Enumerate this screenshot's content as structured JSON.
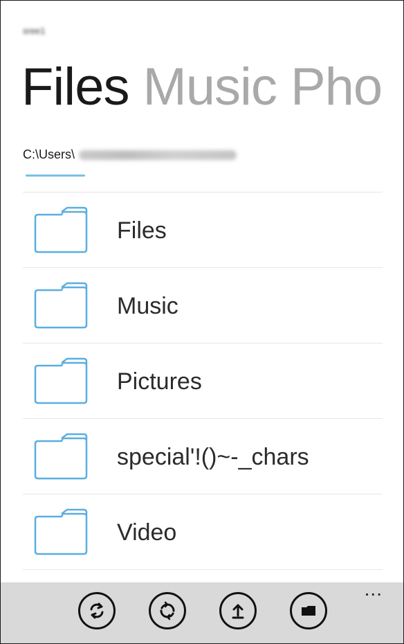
{
  "header": {
    "username": "sree1",
    "pivots": [
      {
        "label": "Files",
        "active": true
      },
      {
        "label": "Music",
        "active": false
      },
      {
        "label": "Pho",
        "active": false
      }
    ]
  },
  "path": {
    "prefix": "C:\\Users\\",
    "hidden_part": "redacted"
  },
  "folders": [
    {
      "name": "Files",
      "icon": "folder-icon"
    },
    {
      "name": "Music",
      "icon": "folder-icon"
    },
    {
      "name": "Pictures",
      "icon": "folder-icon"
    },
    {
      "name": "special'!()~-_chars",
      "icon": "folder-icon"
    },
    {
      "name": "Video",
      "icon": "folder-icon"
    }
  ],
  "appbar": {
    "buttons": [
      {
        "icon": "sync-icon"
      },
      {
        "icon": "refresh-icon"
      },
      {
        "icon": "upload-icon"
      },
      {
        "icon": "folder-icon"
      }
    ],
    "more_label": "..."
  },
  "colors": {
    "accent": "#5aaee0",
    "inactive_pivot": "#a9a9a9",
    "appbar_bg": "#d9d9d9"
  }
}
